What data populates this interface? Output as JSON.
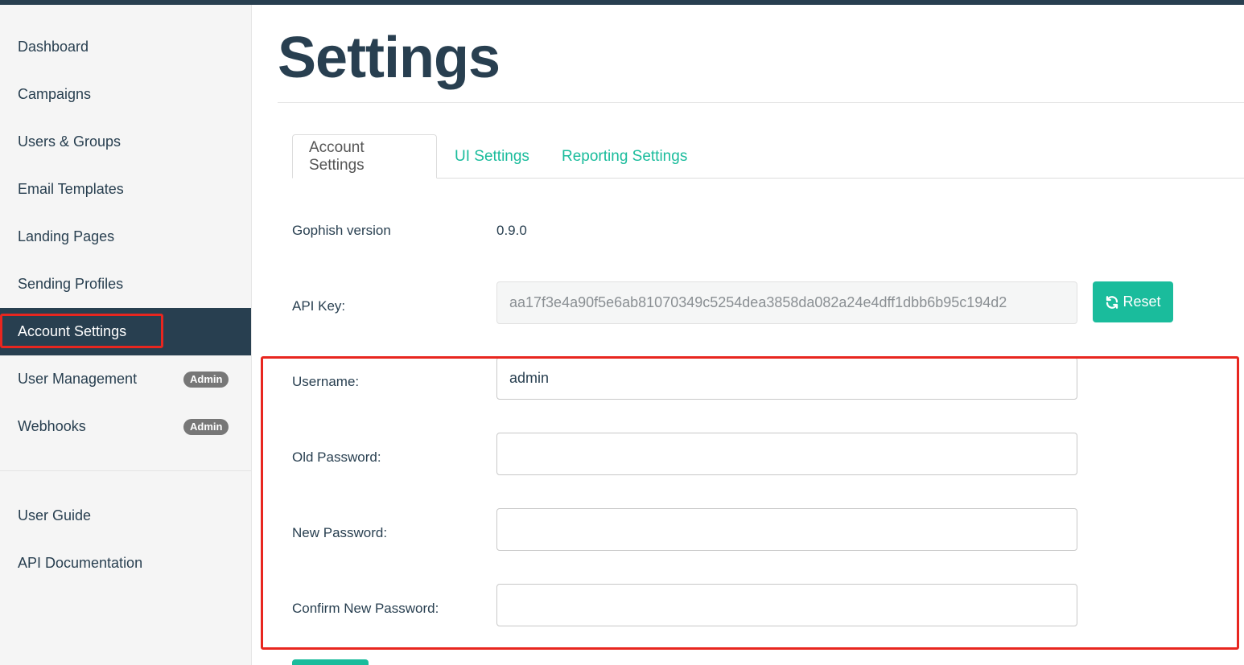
{
  "colors": {
    "nav_dark": "#283f50",
    "accent": "#1abc9c",
    "badge": "#777777",
    "annotation": "#e8261f"
  },
  "sidebar": {
    "items": [
      {
        "label": "Dashboard"
      },
      {
        "label": "Campaigns"
      },
      {
        "label": "Users & Groups"
      },
      {
        "label": "Email Templates"
      },
      {
        "label": "Landing Pages"
      },
      {
        "label": "Sending Profiles"
      },
      {
        "label": "Account Settings",
        "active": true
      },
      {
        "label": "User Management",
        "badge": "Admin"
      },
      {
        "label": "Webhooks",
        "badge": "Admin"
      }
    ],
    "secondary": [
      {
        "label": "User Guide"
      },
      {
        "label": "API Documentation"
      }
    ]
  },
  "page": {
    "title": "Settings"
  },
  "tabs": [
    {
      "label": "Account Settings",
      "active": true
    },
    {
      "label": "UI Settings"
    },
    {
      "label": "Reporting Settings"
    }
  ],
  "account": {
    "version_label": "Gophish version",
    "version_value": "0.9.0",
    "api_key_label": "API Key:",
    "api_key_value": "aa17f3e4a90f5e6ab81070349c5254dea3858da082a24e4dff1dbb6b95c194d2",
    "reset_label": "Reset",
    "reset_icon": "refresh-icon",
    "username_label": "Username:",
    "username_value": "admin",
    "old_password_label": "Old Password:",
    "new_password_label": "New Password:",
    "confirm_password_label": "Confirm New Password:"
  }
}
